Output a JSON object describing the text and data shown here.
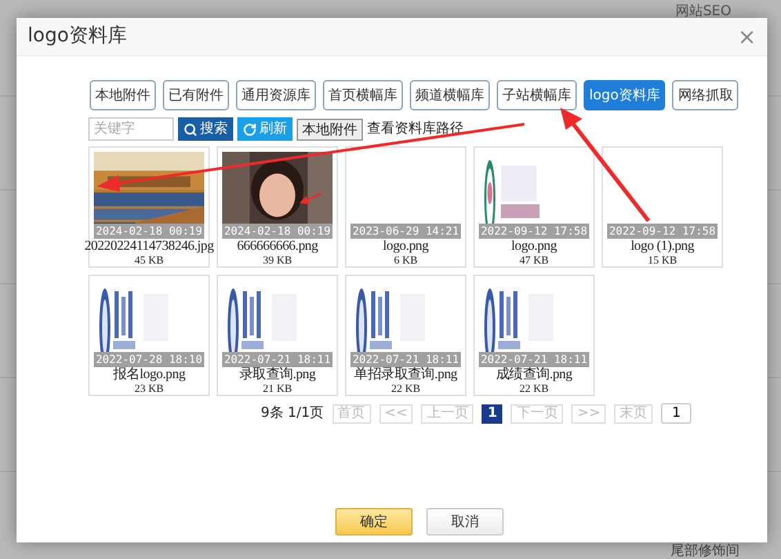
{
  "background": {
    "labels": [
      "网站SEO",
      "尾部修饰间"
    ]
  },
  "dialog": {
    "title": "logo资料库",
    "close": "×",
    "tabs": [
      {
        "label": "本地附件",
        "selected": false
      },
      {
        "label": "已有附件",
        "selected": false
      },
      {
        "label": "通用资源库",
        "selected": false
      },
      {
        "label": "首页横幅库",
        "selected": false
      },
      {
        "label": "频道横幅库",
        "selected": false
      },
      {
        "label": "子站横幅库",
        "selected": false
      },
      {
        "label": "logo资料库",
        "selected": true
      },
      {
        "label": "网络抓取",
        "selected": false
      }
    ],
    "toolbar": {
      "search": {
        "placeholder": "关键字"
      },
      "search_button": "搜索",
      "refresh_button": "刷新",
      "local_button": "本地附件",
      "path_link": "查看资料库路径"
    },
    "files": [
      {
        "kind": "hall",
        "date": "2024-02-18 00:19",
        "name": "20220224114738246.jpg",
        "size": "45 KB"
      },
      {
        "kind": "portrait",
        "date": "2024-02-18 00:19",
        "name": "666666666.png",
        "size": "39 KB"
      },
      {
        "kind": "blank",
        "date": "2023-06-29 14:21",
        "name": "logo.png",
        "size": "6 KB"
      },
      {
        "kind": "ring",
        "date": "2022-09-12 17:58",
        "name": "logo.png",
        "size": "47 KB"
      },
      {
        "kind": "blank",
        "date": "2022-09-12 17:58",
        "name": "logo (1).png",
        "size": "15 KB"
      },
      {
        "kind": "seal",
        "date": "2022-07-28 18:10",
        "name": "报名logo.png",
        "size": "23 KB"
      },
      {
        "kind": "seal",
        "date": "2022-07-21 18:11",
        "name": "录取查询.png",
        "size": "21 KB"
      },
      {
        "kind": "seal",
        "date": "2022-07-21 18:11",
        "name": "单招录取查询.png",
        "size": "22 KB"
      },
      {
        "kind": "seal",
        "date": "2022-07-21 18:11",
        "name": "成绩查询.png",
        "size": "22 KB"
      }
    ],
    "pagination": {
      "summary": "9条 1/1页",
      "pages": [
        {
          "label": "首页",
          "selected": false,
          "disabled": true
        },
        {
          "label": "<<",
          "selected": false,
          "disabled": true
        },
        {
          "label": "上一页",
          "selected": false,
          "disabled": true
        },
        {
          "label": "1",
          "selected": true,
          "disabled": false
        },
        {
          "label": "下一页",
          "selected": false,
          "disabled": true
        },
        {
          "label": ">>",
          "selected": false,
          "disabled": true
        },
        {
          "label": "末页",
          "selected": false,
          "disabled": true
        }
      ],
      "page_input": "1"
    },
    "buttons": [
      {
        "label": "确定",
        "kind": "primary"
      },
      {
        "label": "取消",
        "kind": "secondary"
      }
    ]
  }
}
